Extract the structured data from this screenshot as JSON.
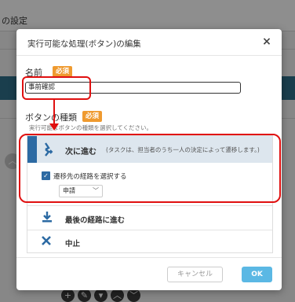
{
  "background": {
    "page_title": "の設定"
  },
  "modal": {
    "title": "実行可能な処理(ボタン)の編集",
    "close_label": "×",
    "name_label": "名前",
    "required_badge": "必須",
    "name_value": "事前確認",
    "type_label": "ボタンの種類",
    "type_hint": "実行可能なボタンの種類を選択してください。",
    "options": [
      {
        "icon": "merge-forward-icon",
        "label": "次に進む",
        "description": "(タスクは、担当者のうち一人の決定によって遷移します。)",
        "checkbox_label": "遷移先の経路を選択する",
        "checkbox_checked": true,
        "select_value": "申請"
      },
      {
        "icon": "download-arrow-icon",
        "label": "最後の経路に進む"
      },
      {
        "icon": "x-icon",
        "label": "中止"
      }
    ],
    "cancel_label": "キャンセル",
    "ok_label": "OK"
  },
  "colors": {
    "accent": "#2c6aa3",
    "required": "#ef9a2f",
    "ok_button": "#5bb8e4",
    "annotation": "#e01010"
  }
}
